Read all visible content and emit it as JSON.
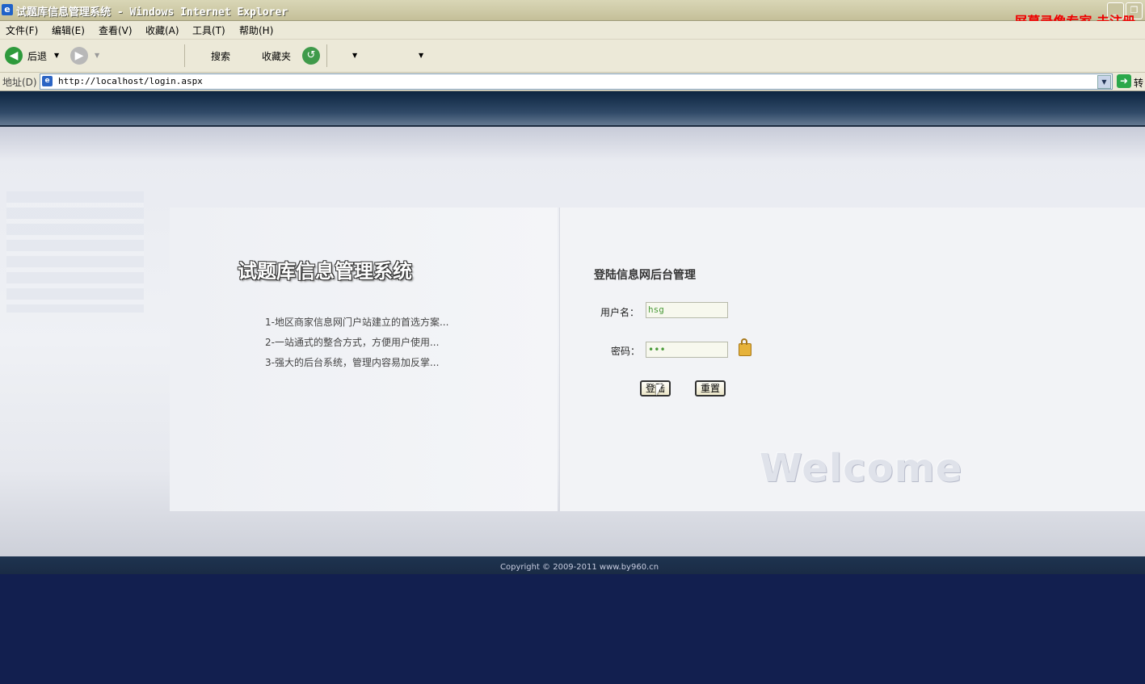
{
  "window": {
    "title": "试题库信息管理系统 - Windows Internet Explorer",
    "recorder_watermark": "屏幕录像专家 未注册"
  },
  "menu": {
    "items": [
      {
        "label": "文件(F)"
      },
      {
        "label": "编辑(E)"
      },
      {
        "label": "查看(V)"
      },
      {
        "label": "收藏(A)"
      },
      {
        "label": "工具(T)"
      },
      {
        "label": "帮助(H)"
      }
    ]
  },
  "toolbar": {
    "back_label": "后退",
    "search_label": "搜索",
    "favorites_label": "收藏夹"
  },
  "address": {
    "label": "地址(D)",
    "url": "http://localhost/login.aspx",
    "go_label": "转"
  },
  "page": {
    "system_title": "试题库信息管理系统",
    "features": [
      "1-地区商家信息网门户站建立的首选方案...",
      "2-一站通式的整合方式，方便用户使用...",
      "3-强大的后台系统，管理内容易加反掌..."
    ],
    "login": {
      "title": "登陆信息网后台管理",
      "username_label": "用户名：",
      "username_value": "hsg",
      "password_label": "密码：",
      "password_value": "•••",
      "login_button": "登陆",
      "reset_button": "重置"
    },
    "welcome_text": "Welcome",
    "copyright": "Copyright © 2009-2011 www.by960.cn"
  }
}
